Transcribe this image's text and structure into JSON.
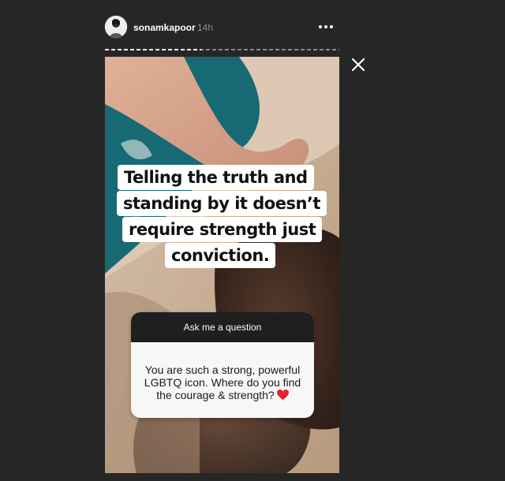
{
  "header": {
    "username": "sonamkapoor",
    "timestamp": "14h",
    "more_icon": "more-horizontal-icon",
    "close_icon": "close-icon",
    "progress_fraction": 0.41
  },
  "story": {
    "quote_lines": [
      "Telling the truth and",
      "standing by it doesn’t",
      "require strength just",
      "conviction."
    ],
    "question_card": {
      "header": "Ask me a question",
      "lines": [
        "You are such a strong, powerful",
        "LGBTQ icon. Where do you find",
        "the courage & strength?"
      ],
      "emoji": "heart-icon"
    }
  },
  "colors": {
    "background": "#262626",
    "card_header": "#1f1f1f",
    "teal_fabric": "#176a73",
    "heart": "#e0242f"
  }
}
